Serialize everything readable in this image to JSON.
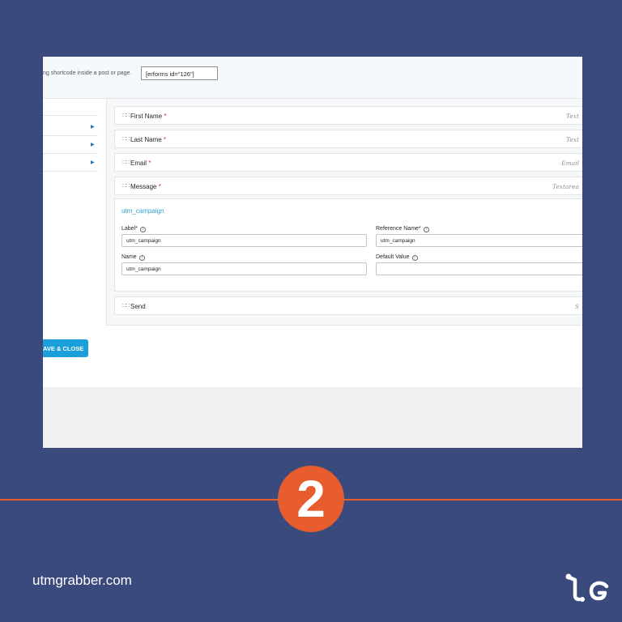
{
  "topbar": {
    "info_text": "ng shortcode inside a post or page.",
    "shortcode": "[erforms id=\"126\"]"
  },
  "fields": [
    {
      "label": "First Name",
      "required": "*",
      "type": "Text"
    },
    {
      "label": "Last Name",
      "required": "*",
      "type": "Text"
    },
    {
      "label": "Email",
      "required": "*",
      "type": "Email"
    },
    {
      "label": "Message",
      "required": "*",
      "type": "Textarea"
    }
  ],
  "editor": {
    "title": "utm_campaign",
    "label_label": "Label*",
    "label_value": "utm_campaign",
    "reference_label": "Reference Name*",
    "reference_value": "utm_campaign",
    "name_label": "Name",
    "name_value": "utm_campaign",
    "default_label": "Default Value",
    "default_value": ""
  },
  "send_row": {
    "label": "Send",
    "type": "S"
  },
  "save_button": "AVE & CLOSE",
  "step_number": "2",
  "footer": {
    "site": "utmgrabber.com"
  },
  "icons": {
    "drag": "drag-handle-icon",
    "info": "info-icon",
    "arrow": "triangle-right-icon",
    "logo": "utmgrabber-logo-icon"
  },
  "colors": {
    "background": "#3a4a7c",
    "accent": "#e85d2e",
    "button": "#1a9fdb",
    "link": "#2ea2cc",
    "required": "#d63638"
  }
}
